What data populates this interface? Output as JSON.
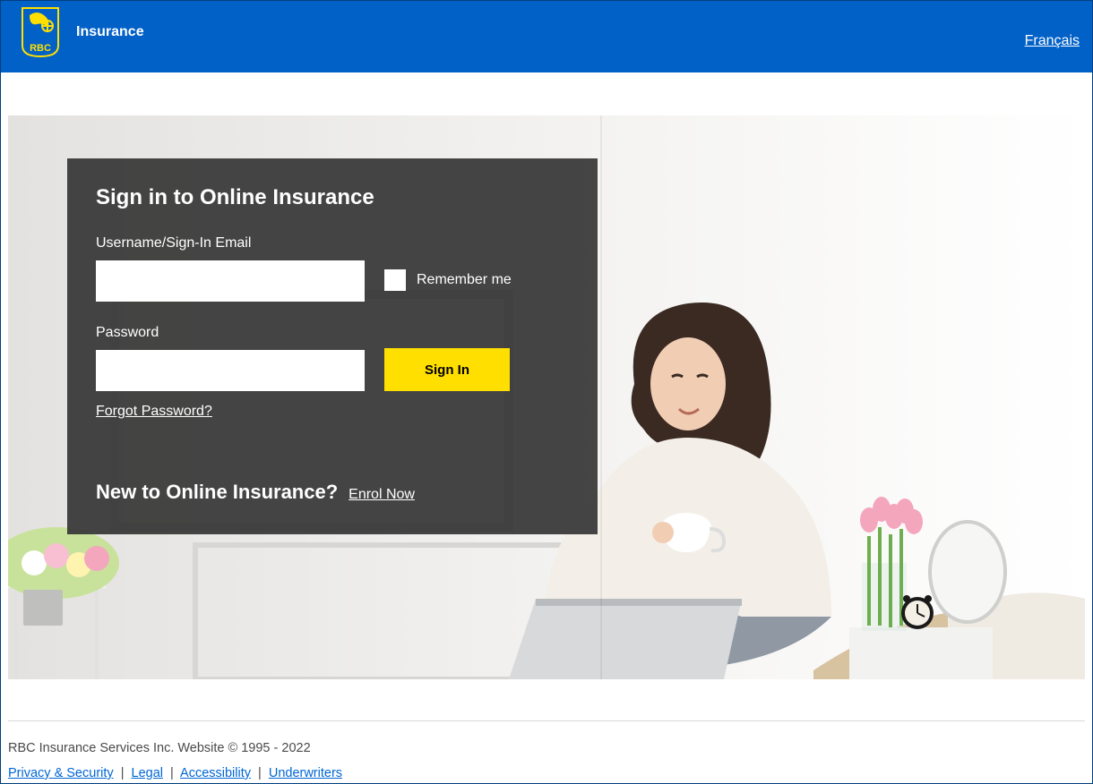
{
  "header": {
    "brand": "Insurance",
    "lang_link": "Français"
  },
  "card": {
    "title": "Sign in to Online Insurance",
    "username_label": "Username/Sign-In Email",
    "password_label": "Password",
    "remember_label": "Remember me",
    "signin_label": "Sign In",
    "forgot_label": "Forgot Password?",
    "new_title": "New to Online Insurance?",
    "enrol_label": "Enrol Now"
  },
  "footer": {
    "copyright": "RBC Insurance Services Inc. Website © 1995 - 2022",
    "links": {
      "privacy": "Privacy & Security",
      "legal": "Legal",
      "accessibility": "Accessibility",
      "underwriters": "Underwriters"
    }
  }
}
